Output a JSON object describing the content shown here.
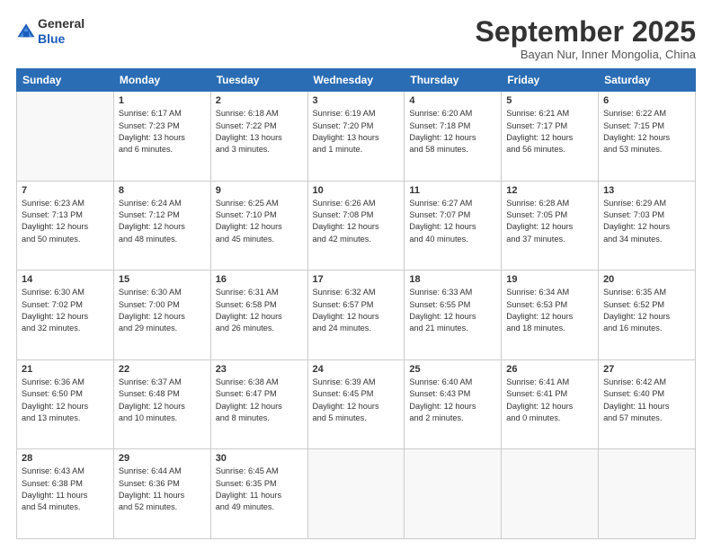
{
  "header": {
    "logo_general": "General",
    "logo_blue": "Blue",
    "month": "September 2025",
    "location": "Bayan Nur, Inner Mongolia, China"
  },
  "weekdays": [
    "Sunday",
    "Monday",
    "Tuesday",
    "Wednesday",
    "Thursday",
    "Friday",
    "Saturday"
  ],
  "weeks": [
    [
      {
        "day": "",
        "info": ""
      },
      {
        "day": "1",
        "info": "Sunrise: 6:17 AM\nSunset: 7:23 PM\nDaylight: 13 hours\nand 6 minutes."
      },
      {
        "day": "2",
        "info": "Sunrise: 6:18 AM\nSunset: 7:22 PM\nDaylight: 13 hours\nand 3 minutes."
      },
      {
        "day": "3",
        "info": "Sunrise: 6:19 AM\nSunset: 7:20 PM\nDaylight: 13 hours\nand 1 minute."
      },
      {
        "day": "4",
        "info": "Sunrise: 6:20 AM\nSunset: 7:18 PM\nDaylight: 12 hours\nand 58 minutes."
      },
      {
        "day": "5",
        "info": "Sunrise: 6:21 AM\nSunset: 7:17 PM\nDaylight: 12 hours\nand 56 minutes."
      },
      {
        "day": "6",
        "info": "Sunrise: 6:22 AM\nSunset: 7:15 PM\nDaylight: 12 hours\nand 53 minutes."
      }
    ],
    [
      {
        "day": "7",
        "info": "Sunrise: 6:23 AM\nSunset: 7:13 PM\nDaylight: 12 hours\nand 50 minutes."
      },
      {
        "day": "8",
        "info": "Sunrise: 6:24 AM\nSunset: 7:12 PM\nDaylight: 12 hours\nand 48 minutes."
      },
      {
        "day": "9",
        "info": "Sunrise: 6:25 AM\nSunset: 7:10 PM\nDaylight: 12 hours\nand 45 minutes."
      },
      {
        "day": "10",
        "info": "Sunrise: 6:26 AM\nSunset: 7:08 PM\nDaylight: 12 hours\nand 42 minutes."
      },
      {
        "day": "11",
        "info": "Sunrise: 6:27 AM\nSunset: 7:07 PM\nDaylight: 12 hours\nand 40 minutes."
      },
      {
        "day": "12",
        "info": "Sunrise: 6:28 AM\nSunset: 7:05 PM\nDaylight: 12 hours\nand 37 minutes."
      },
      {
        "day": "13",
        "info": "Sunrise: 6:29 AM\nSunset: 7:03 PM\nDaylight: 12 hours\nand 34 minutes."
      }
    ],
    [
      {
        "day": "14",
        "info": "Sunrise: 6:30 AM\nSunset: 7:02 PM\nDaylight: 12 hours\nand 32 minutes."
      },
      {
        "day": "15",
        "info": "Sunrise: 6:30 AM\nSunset: 7:00 PM\nDaylight: 12 hours\nand 29 minutes."
      },
      {
        "day": "16",
        "info": "Sunrise: 6:31 AM\nSunset: 6:58 PM\nDaylight: 12 hours\nand 26 minutes."
      },
      {
        "day": "17",
        "info": "Sunrise: 6:32 AM\nSunset: 6:57 PM\nDaylight: 12 hours\nand 24 minutes."
      },
      {
        "day": "18",
        "info": "Sunrise: 6:33 AM\nSunset: 6:55 PM\nDaylight: 12 hours\nand 21 minutes."
      },
      {
        "day": "19",
        "info": "Sunrise: 6:34 AM\nSunset: 6:53 PM\nDaylight: 12 hours\nand 18 minutes."
      },
      {
        "day": "20",
        "info": "Sunrise: 6:35 AM\nSunset: 6:52 PM\nDaylight: 12 hours\nand 16 minutes."
      }
    ],
    [
      {
        "day": "21",
        "info": "Sunrise: 6:36 AM\nSunset: 6:50 PM\nDaylight: 12 hours\nand 13 minutes."
      },
      {
        "day": "22",
        "info": "Sunrise: 6:37 AM\nSunset: 6:48 PM\nDaylight: 12 hours\nand 10 minutes."
      },
      {
        "day": "23",
        "info": "Sunrise: 6:38 AM\nSunset: 6:47 PM\nDaylight: 12 hours\nand 8 minutes."
      },
      {
        "day": "24",
        "info": "Sunrise: 6:39 AM\nSunset: 6:45 PM\nDaylight: 12 hours\nand 5 minutes."
      },
      {
        "day": "25",
        "info": "Sunrise: 6:40 AM\nSunset: 6:43 PM\nDaylight: 12 hours\nand 2 minutes."
      },
      {
        "day": "26",
        "info": "Sunrise: 6:41 AM\nSunset: 6:41 PM\nDaylight: 12 hours\nand 0 minutes."
      },
      {
        "day": "27",
        "info": "Sunrise: 6:42 AM\nSunset: 6:40 PM\nDaylight: 11 hours\nand 57 minutes."
      }
    ],
    [
      {
        "day": "28",
        "info": "Sunrise: 6:43 AM\nSunset: 6:38 PM\nDaylight: 11 hours\nand 54 minutes."
      },
      {
        "day": "29",
        "info": "Sunrise: 6:44 AM\nSunset: 6:36 PM\nDaylight: 11 hours\nand 52 minutes."
      },
      {
        "day": "30",
        "info": "Sunrise: 6:45 AM\nSunset: 6:35 PM\nDaylight: 11 hours\nand 49 minutes."
      },
      {
        "day": "",
        "info": ""
      },
      {
        "day": "",
        "info": ""
      },
      {
        "day": "",
        "info": ""
      },
      {
        "day": "",
        "info": ""
      }
    ]
  ]
}
